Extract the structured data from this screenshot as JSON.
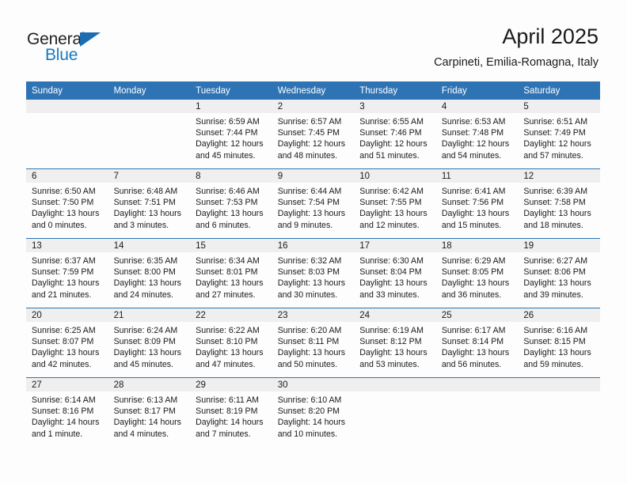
{
  "brand": {
    "name_part1": "General",
    "name_part2": "Blue",
    "triangle_color": "#1b6cb0",
    "blue_text_color": "#1879bf"
  },
  "header": {
    "title": "April 2025",
    "subtitle": "Carpineti, Emilia-Romagna, Italy"
  },
  "theme": {
    "header_blue": "#2e74b5",
    "daynum_band_gray": "#efefef",
    "page_background": "#fdfdfd",
    "text_color": "#1a1a1a"
  },
  "calendar": {
    "weekday_headers": [
      "Sunday",
      "Monday",
      "Tuesday",
      "Wednesday",
      "Thursday",
      "Friday",
      "Saturday"
    ],
    "weeks": [
      [
        {
          "day": "",
          "lines": []
        },
        {
          "day": "",
          "lines": []
        },
        {
          "day": "1",
          "lines": [
            "Sunrise: 6:59 AM",
            "Sunset: 7:44 PM",
            "Daylight: 12 hours",
            "and 45 minutes."
          ]
        },
        {
          "day": "2",
          "lines": [
            "Sunrise: 6:57 AM",
            "Sunset: 7:45 PM",
            "Daylight: 12 hours",
            "and 48 minutes."
          ]
        },
        {
          "day": "3",
          "lines": [
            "Sunrise: 6:55 AM",
            "Sunset: 7:46 PM",
            "Daylight: 12 hours",
            "and 51 minutes."
          ]
        },
        {
          "day": "4",
          "lines": [
            "Sunrise: 6:53 AM",
            "Sunset: 7:48 PM",
            "Daylight: 12 hours",
            "and 54 minutes."
          ]
        },
        {
          "day": "5",
          "lines": [
            "Sunrise: 6:51 AM",
            "Sunset: 7:49 PM",
            "Daylight: 12 hours",
            "and 57 minutes."
          ]
        }
      ],
      [
        {
          "day": "6",
          "lines": [
            "Sunrise: 6:50 AM",
            "Sunset: 7:50 PM",
            "Daylight: 13 hours",
            "and 0 minutes."
          ]
        },
        {
          "day": "7",
          "lines": [
            "Sunrise: 6:48 AM",
            "Sunset: 7:51 PM",
            "Daylight: 13 hours",
            "and 3 minutes."
          ]
        },
        {
          "day": "8",
          "lines": [
            "Sunrise: 6:46 AM",
            "Sunset: 7:53 PM",
            "Daylight: 13 hours",
            "and 6 minutes."
          ]
        },
        {
          "day": "9",
          "lines": [
            "Sunrise: 6:44 AM",
            "Sunset: 7:54 PM",
            "Daylight: 13 hours",
            "and 9 minutes."
          ]
        },
        {
          "day": "10",
          "lines": [
            "Sunrise: 6:42 AM",
            "Sunset: 7:55 PM",
            "Daylight: 13 hours",
            "and 12 minutes."
          ]
        },
        {
          "day": "11",
          "lines": [
            "Sunrise: 6:41 AM",
            "Sunset: 7:56 PM",
            "Daylight: 13 hours",
            "and 15 minutes."
          ]
        },
        {
          "day": "12",
          "lines": [
            "Sunrise: 6:39 AM",
            "Sunset: 7:58 PM",
            "Daylight: 13 hours",
            "and 18 minutes."
          ]
        }
      ],
      [
        {
          "day": "13",
          "lines": [
            "Sunrise: 6:37 AM",
            "Sunset: 7:59 PM",
            "Daylight: 13 hours",
            "and 21 minutes."
          ]
        },
        {
          "day": "14",
          "lines": [
            "Sunrise: 6:35 AM",
            "Sunset: 8:00 PM",
            "Daylight: 13 hours",
            "and 24 minutes."
          ]
        },
        {
          "day": "15",
          "lines": [
            "Sunrise: 6:34 AM",
            "Sunset: 8:01 PM",
            "Daylight: 13 hours",
            "and 27 minutes."
          ]
        },
        {
          "day": "16",
          "lines": [
            "Sunrise: 6:32 AM",
            "Sunset: 8:03 PM",
            "Daylight: 13 hours",
            "and 30 minutes."
          ]
        },
        {
          "day": "17",
          "lines": [
            "Sunrise: 6:30 AM",
            "Sunset: 8:04 PM",
            "Daylight: 13 hours",
            "and 33 minutes."
          ]
        },
        {
          "day": "18",
          "lines": [
            "Sunrise: 6:29 AM",
            "Sunset: 8:05 PM",
            "Daylight: 13 hours",
            "and 36 minutes."
          ]
        },
        {
          "day": "19",
          "lines": [
            "Sunrise: 6:27 AM",
            "Sunset: 8:06 PM",
            "Daylight: 13 hours",
            "and 39 minutes."
          ]
        }
      ],
      [
        {
          "day": "20",
          "lines": [
            "Sunrise: 6:25 AM",
            "Sunset: 8:07 PM",
            "Daylight: 13 hours",
            "and 42 minutes."
          ]
        },
        {
          "day": "21",
          "lines": [
            "Sunrise: 6:24 AM",
            "Sunset: 8:09 PM",
            "Daylight: 13 hours",
            "and 45 minutes."
          ]
        },
        {
          "day": "22",
          "lines": [
            "Sunrise: 6:22 AM",
            "Sunset: 8:10 PM",
            "Daylight: 13 hours",
            "and 47 minutes."
          ]
        },
        {
          "day": "23",
          "lines": [
            "Sunrise: 6:20 AM",
            "Sunset: 8:11 PM",
            "Daylight: 13 hours",
            "and 50 minutes."
          ]
        },
        {
          "day": "24",
          "lines": [
            "Sunrise: 6:19 AM",
            "Sunset: 8:12 PM",
            "Daylight: 13 hours",
            "and 53 minutes."
          ]
        },
        {
          "day": "25",
          "lines": [
            "Sunrise: 6:17 AM",
            "Sunset: 8:14 PM",
            "Daylight: 13 hours",
            "and 56 minutes."
          ]
        },
        {
          "day": "26",
          "lines": [
            "Sunrise: 6:16 AM",
            "Sunset: 8:15 PM",
            "Daylight: 13 hours",
            "and 59 minutes."
          ]
        }
      ],
      [
        {
          "day": "27",
          "lines": [
            "Sunrise: 6:14 AM",
            "Sunset: 8:16 PM",
            "Daylight: 14 hours",
            "and 1 minute."
          ]
        },
        {
          "day": "28",
          "lines": [
            "Sunrise: 6:13 AM",
            "Sunset: 8:17 PM",
            "Daylight: 14 hours",
            "and 4 minutes."
          ]
        },
        {
          "day": "29",
          "lines": [
            "Sunrise: 6:11 AM",
            "Sunset: 8:19 PM",
            "Daylight: 14 hours",
            "and 7 minutes."
          ]
        },
        {
          "day": "30",
          "lines": [
            "Sunrise: 6:10 AM",
            "Sunset: 8:20 PM",
            "Daylight: 14 hours",
            "and 10 minutes."
          ]
        },
        {
          "day": "",
          "lines": []
        },
        {
          "day": "",
          "lines": []
        },
        {
          "day": "",
          "lines": []
        }
      ]
    ]
  }
}
